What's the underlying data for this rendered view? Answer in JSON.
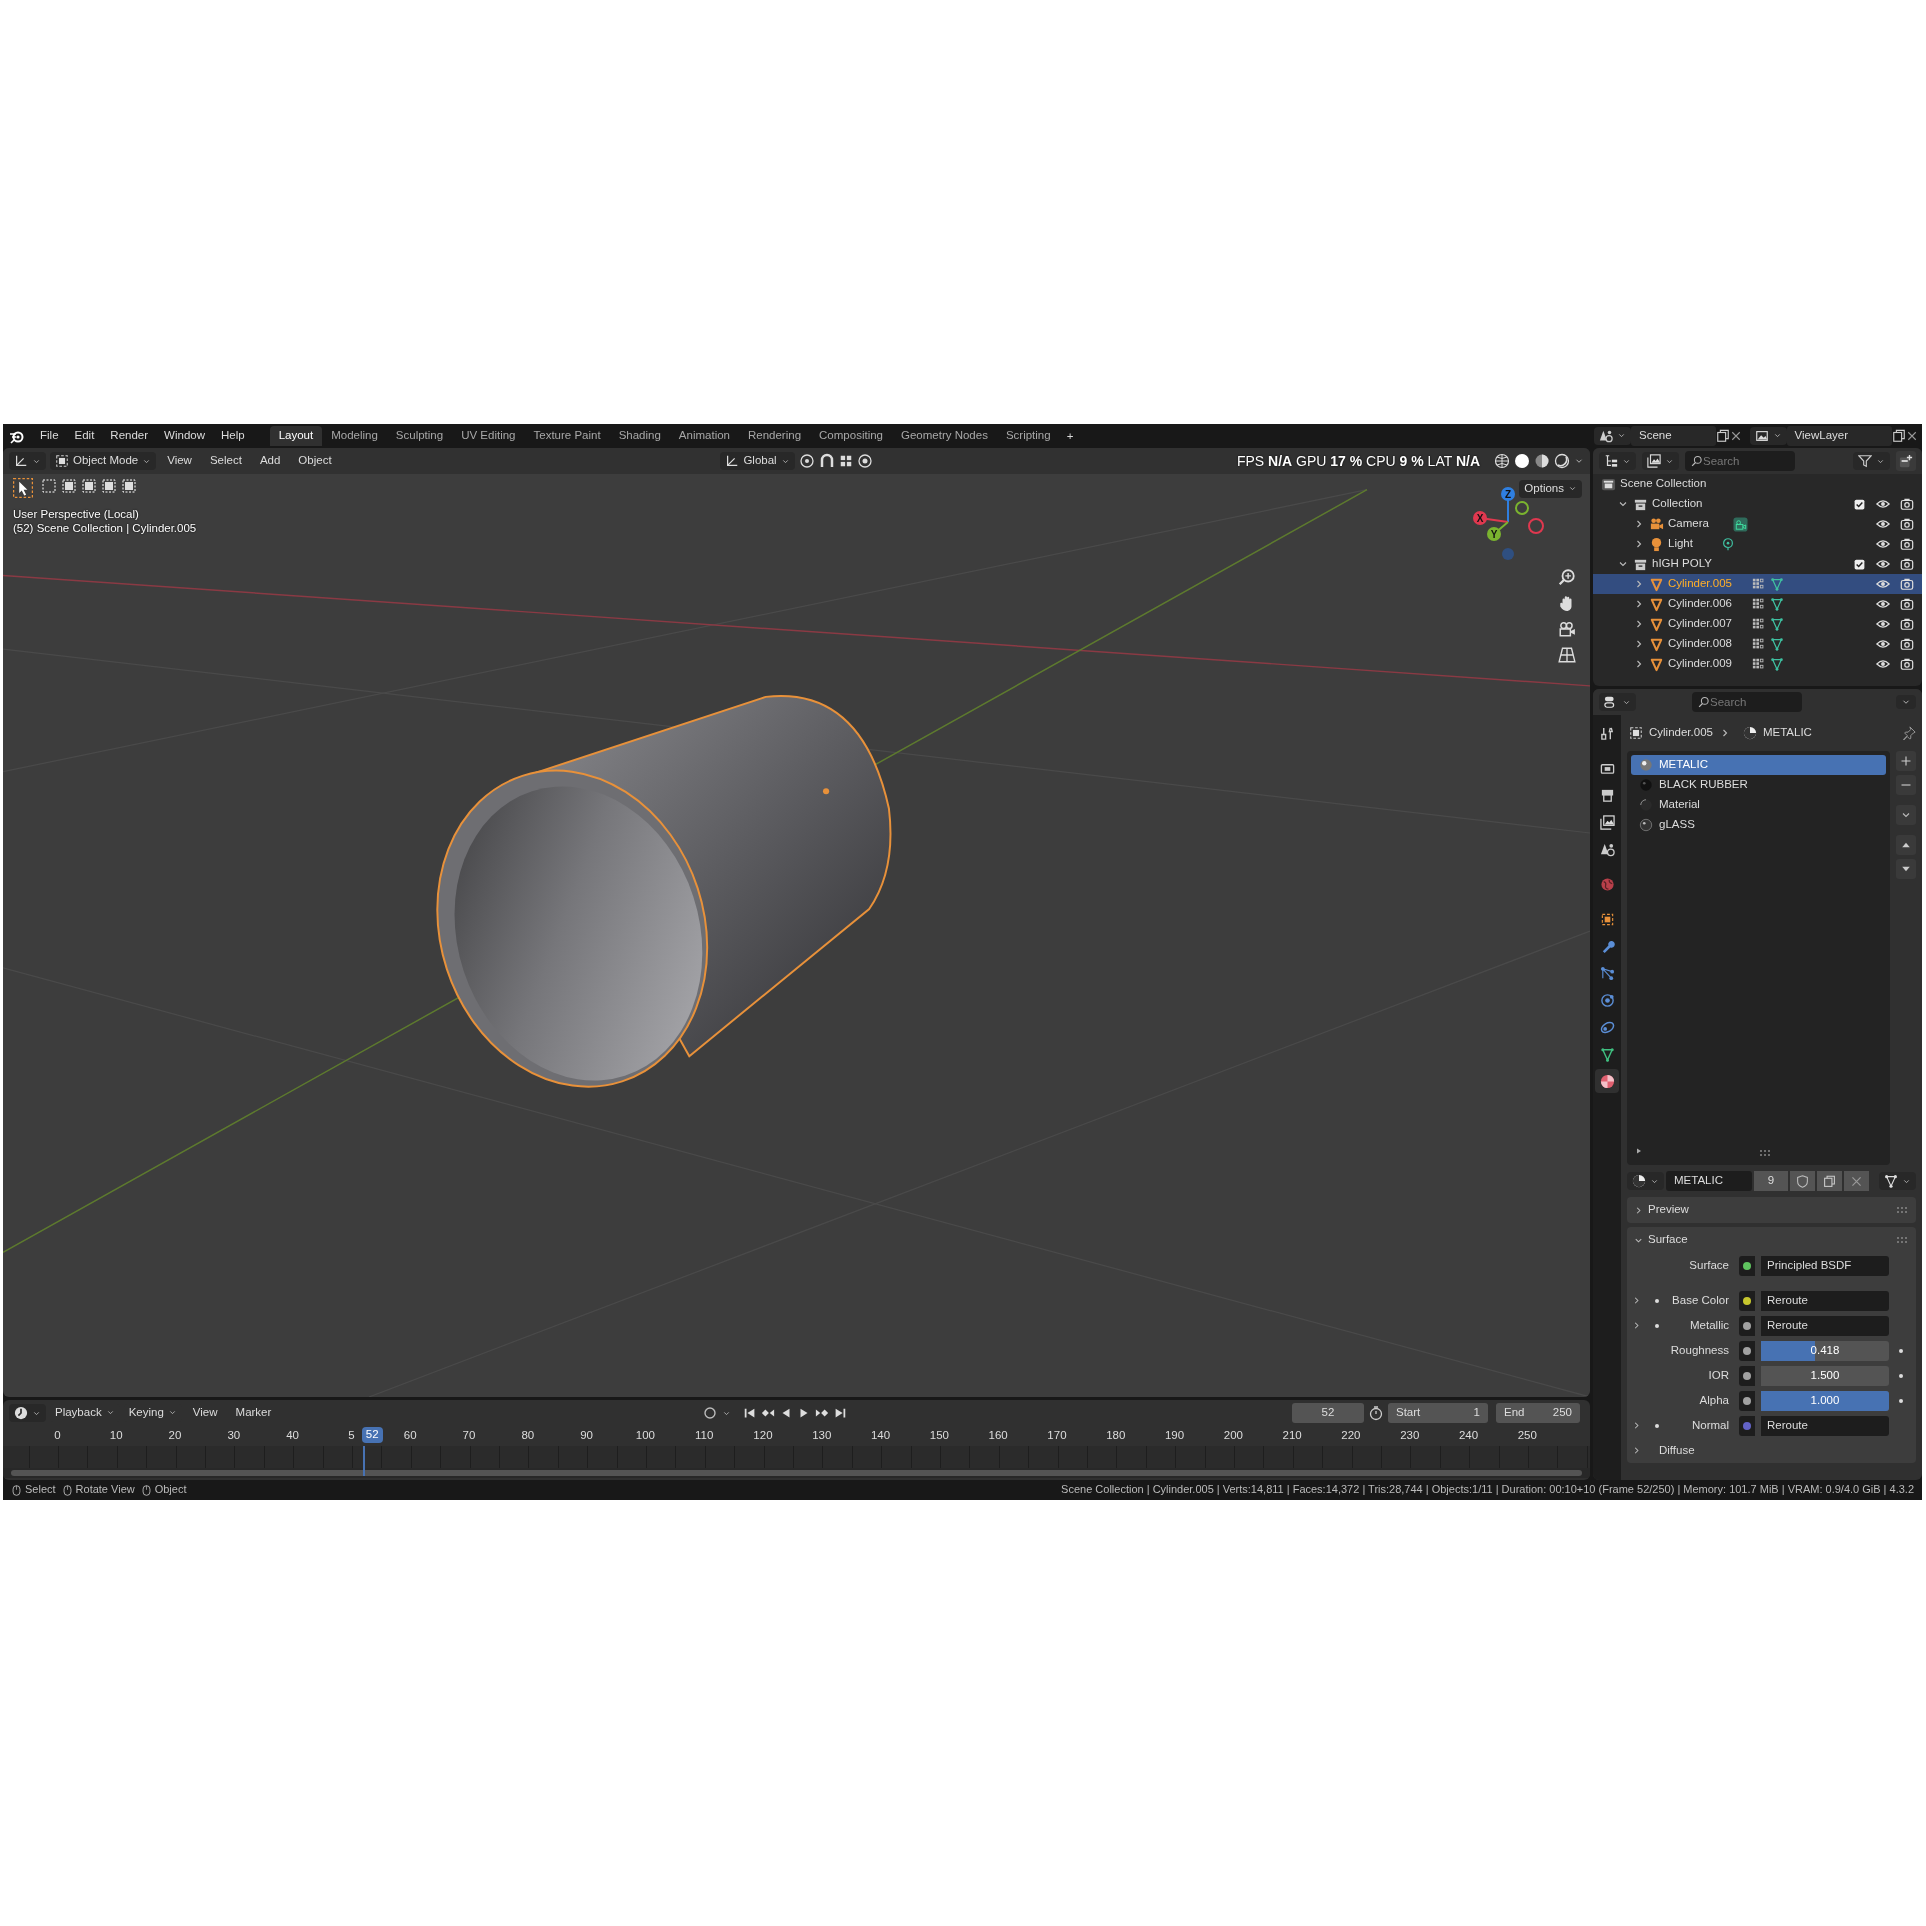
{
  "top_bar": {
    "menus": [
      "File",
      "Edit",
      "Render",
      "Window",
      "Help"
    ],
    "workspaces": [
      {
        "label": "Layout",
        "selected": true
      },
      {
        "label": "Modeling",
        "selected": false
      },
      {
        "label": "Sculpting",
        "selected": false
      },
      {
        "label": "UV Editing",
        "selected": false
      },
      {
        "label": "Texture Paint",
        "selected": false
      },
      {
        "label": "Shading",
        "selected": false
      },
      {
        "label": "Animation",
        "selected": false
      },
      {
        "label": "Rendering",
        "selected": false
      },
      {
        "label": "Compositing",
        "selected": false
      },
      {
        "label": "Geometry Nodes",
        "selected": false
      },
      {
        "label": "Scripting",
        "selected": false
      }
    ],
    "add_workspace": "+",
    "scene": "Scene",
    "view_layer": "ViewLayer"
  },
  "viewport": {
    "mode": "Object Mode",
    "menus": [
      "View",
      "Select",
      "Add",
      "Object"
    ],
    "orientation": "Global",
    "stats": "FPS **N/A** GPU **17 %** CPU **9 %** LAT **N/A**",
    "options": "Options",
    "info": [
      "User Perspective (Local)",
      "(52) Scene Collection | Cylinder.005"
    ],
    "gizmo": [
      {
        "label": "Z",
        "color": "#2f7fe0"
      },
      {
        "label": "X",
        "color": "#e0384f"
      },
      {
        "label": "Y",
        "color": "#7ab32f"
      }
    ]
  },
  "outliner": {
    "search": {
      "placeholder": "Search"
    },
    "tree": [
      {
        "label": "Scene Collection",
        "kind": "scene",
        "selected": false,
        "children": [
          {
            "label": "Collection",
            "kind": "collection",
            "expanded": true,
            "checked": true,
            "selected": false,
            "children": [
              {
                "label": "Camera",
                "kind": "camera",
                "expanded": false,
                "selected": false
              },
              {
                "label": "Light",
                "kind": "light",
                "expanded": false,
                "selected": false
              }
            ]
          },
          {
            "label": "hIGH POLY",
            "kind": "collection",
            "expanded": true,
            "checked": true,
            "selected": false,
            "children": [
              {
                "label": "Cylinder.005",
                "kind": "mesh",
                "expanded": false,
                "selected": true
              },
              {
                "label": "Cylinder.006",
                "kind": "mesh",
                "expanded": false,
                "selected": false
              },
              {
                "label": "Cylinder.007",
                "kind": "mesh",
                "expanded": false,
                "selected": false
              },
              {
                "label": "Cylinder.008",
                "kind": "mesh",
                "expanded": false,
                "selected": false
              },
              {
                "label": "Cylinder.009",
                "kind": "mesh",
                "expanded": false,
                "selected": false
              }
            ]
          }
        ]
      }
    ]
  },
  "properties": {
    "search": {
      "placeholder": "Search"
    },
    "tabs": [
      {
        "kind": "tool",
        "selected": false
      },
      {
        "kind": "render",
        "selected": false
      },
      {
        "kind": "output",
        "selected": false
      },
      {
        "kind": "view_layer",
        "selected": false
      },
      {
        "kind": "scene",
        "selected": false
      },
      {
        "kind": "world",
        "selected": false
      },
      {
        "kind": "object",
        "selected": false
      },
      {
        "kind": "modifiers",
        "selected": false
      },
      {
        "kind": "particles",
        "selected": false
      },
      {
        "kind": "physics",
        "selected": false
      },
      {
        "kind": "constraints",
        "selected": false
      },
      {
        "kind": "data",
        "selected": false
      },
      {
        "kind": "material",
        "selected": true
      }
    ],
    "breadcrumb": [
      "Cylinder.005",
      "METALIC"
    ],
    "material_slots": [
      {
        "label": "METALIC",
        "selected": true
      },
      {
        "label": "BLACK RUBBER",
        "selected": false
      },
      {
        "label": "Material",
        "selected": false
      },
      {
        "label": "gLASS",
        "selected": false
      }
    ],
    "material": {
      "name": "METALIC",
      "users": "9"
    },
    "panels": [
      {
        "title": "Preview",
        "expanded": false
      },
      {
        "title": "Surface",
        "expanded": true,
        "rows": [
          {
            "kind": "shader",
            "label": "Surface",
            "value": "Principled BSDF",
            "color": "#5fc35f"
          },
          {
            "kind": "link",
            "label": "Base Color",
            "value": "Reroute",
            "color": "#c7c72e",
            "expanded": false
          },
          {
            "kind": "link",
            "label": "Metallic",
            "value": "Reroute",
            "color": "#a1a1a1",
            "expanded": false
          },
          {
            "kind": "slider",
            "label": "Roughness",
            "value": "0.418",
            "level": 0.418,
            "color": "#a1a1a1"
          },
          {
            "kind": "number",
            "label": "IOR",
            "value": "1.500",
            "color": "#a1a1a1"
          },
          {
            "kind": "slider",
            "label": "Alpha",
            "value": "1.000",
            "level": 1,
            "color": "#a1a1a1"
          },
          {
            "kind": "link",
            "label": "Normal",
            "value": "Reroute",
            "color": "#6363c7",
            "expanded": false
          },
          {
            "kind": "group",
            "label": "Diffuse",
            "expanded": false
          }
        ]
      }
    ]
  },
  "timeline": {
    "menus": [
      "Playback",
      "Keying",
      "View",
      "Marker"
    ],
    "current_frame": "52",
    "start": {
      "label": "Start",
      "value": "1"
    },
    "end": {
      "label": "End",
      "value": "250"
    },
    "playhead": {
      "label": "52",
      "level": 0.208
    },
    "ticks": [
      "0",
      "10",
      "20",
      "30",
      "40",
      "5",
      "60",
      "70",
      "80",
      "90",
      "100",
      "110",
      "120",
      "130",
      "140",
      "150",
      "160",
      "170",
      "180",
      "190",
      "200",
      "210",
      "220",
      "230",
      "240",
      "250"
    ]
  },
  "status_bar": {
    "hints": [
      "Select",
      "Rotate View",
      "Object"
    ],
    "info": "Scene Collection | Cylinder.005 | Verts:14,811 | Faces:14,372 | Tris:28,744 | Objects:1/11 | Duration: 00:10+10 (Frame 52/250) | Memory: 101.7 MiB | VRAM: 0.9/4.0 GiB | 4.3.2"
  }
}
